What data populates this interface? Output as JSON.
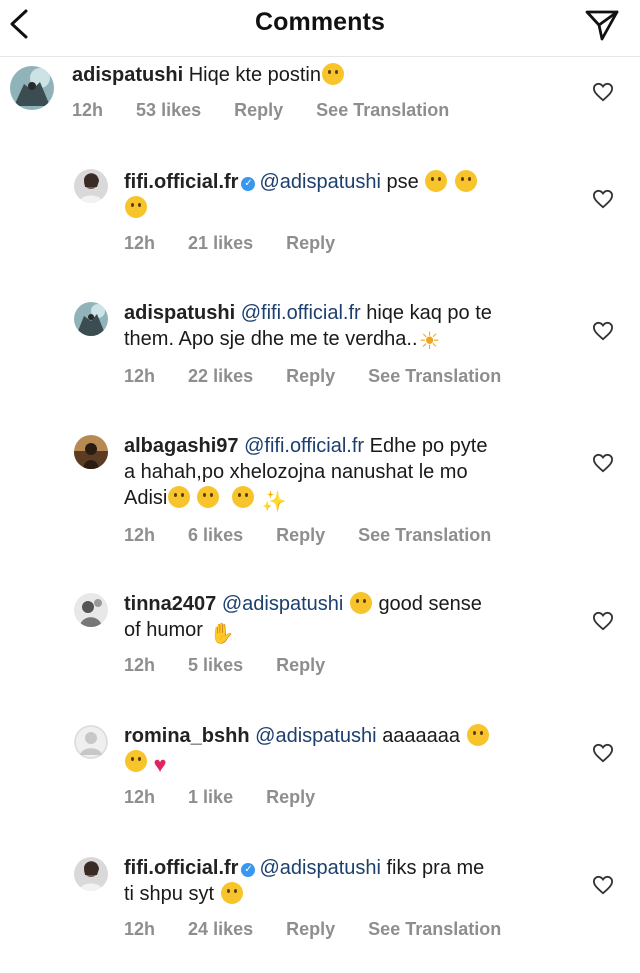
{
  "header": {
    "title": "Comments",
    "back_icon": "chevron-left-icon",
    "share_icon": "paper-plane-icon"
  },
  "colors": {
    "verified": "#3897f0",
    "mention": "#1d3f6e",
    "meta": "#8e8e8e"
  },
  "comments": [
    {
      "user": "adispatushi",
      "verified": false,
      "mention": "",
      "text": "Hiqe kte postin",
      "emojis": [
        "thinking-face"
      ],
      "time": "12h",
      "likes": "53 likes",
      "reply": "Reply",
      "translation": "See Translation"
    },
    {
      "user": "fifi.official.fr",
      "verified": true,
      "mention": "@adispatushi",
      "text": "pse",
      "emojis": [
        "grinning-sweat-face",
        "grinning-sweat-face",
        "grinning-sweat-face"
      ],
      "time": "12h",
      "likes": "21 likes",
      "reply": "Reply",
      "translation": ""
    },
    {
      "user": "adispatushi",
      "verified": false,
      "mention": "@fifi.official.fr",
      "text_line1": "hiqe kaq po te",
      "text_line2": "them. Apo sje dhe me te verdha..",
      "emojis": [
        "sun"
      ],
      "time": "12h",
      "likes": "22 likes",
      "reply": "Reply",
      "translation": "See Translation"
    },
    {
      "user": "albagashi97",
      "verified": false,
      "mention": "@fifi.official.fr",
      "text_line1": "Edhe po pyte",
      "text_line2": "a hahah,po xhelozojna nanushat le mo",
      "text_line3": "Adisi",
      "emojis": [
        "rolling-laughing-face",
        "star-struck-face",
        "heart-eyes-cat",
        "sparkles"
      ],
      "time": "12h",
      "likes": "6 likes",
      "reply": "Reply",
      "translation": "See Translation"
    },
    {
      "user": "tinna2407",
      "verified": false,
      "mention": "@adispatushi",
      "text_line1": "good sense",
      "text_line2": "of humor",
      "emojis": [
        "crying-laughing-face",
        "raising-hands"
      ],
      "time": "12h",
      "likes": "5 likes",
      "reply": "Reply",
      "translation": ""
    },
    {
      "user": "romina_bshh",
      "verified": false,
      "mention": "@adispatushi",
      "text": "aaaaaaa",
      "emojis": [
        "heart-eyes-face",
        "heart-eyes-face",
        "red-heart"
      ],
      "time": "12h",
      "likes": "1 like",
      "reply": "Reply",
      "translation": ""
    },
    {
      "user": "fifi.official.fr",
      "verified": true,
      "mention": "@adispatushi",
      "text_line1": "fiks pra me",
      "text_line2": "ti shpu syt",
      "emojis": [
        "crying-laughing-face"
      ],
      "time": "12h",
      "likes": "24 likes",
      "reply": "Reply",
      "translation": "See Translation"
    }
  ]
}
